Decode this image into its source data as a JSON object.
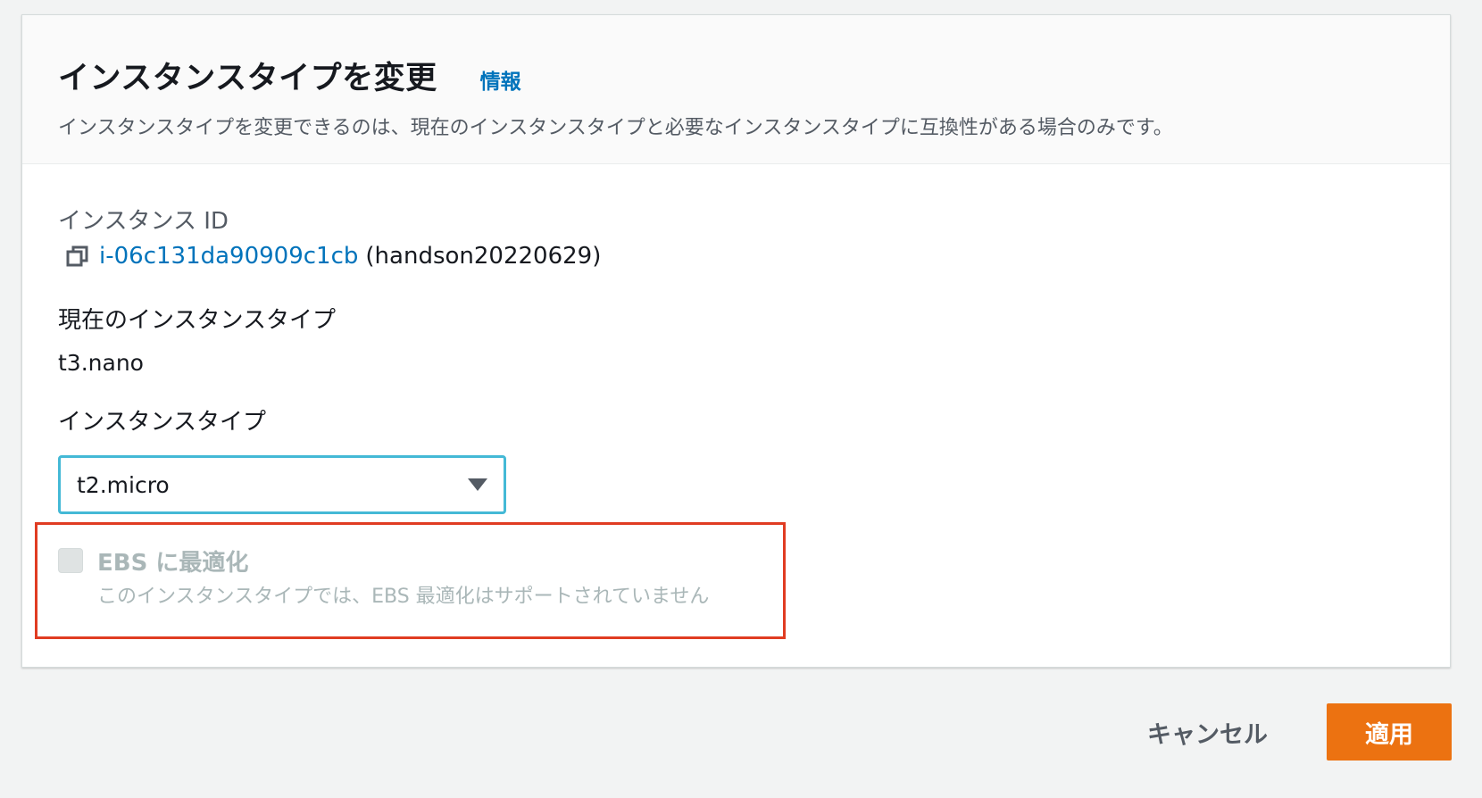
{
  "header": {
    "title": "インスタンスタイプを変更",
    "info_link": "情報",
    "description": "インスタンスタイプを変更できるのは、現在のインスタンスタイプと必要なインスタンスタイプに互換性がある場合のみです。"
  },
  "instance_id": {
    "label": "インスタンス ID",
    "id": "i-06c131da90909c1cb",
    "name": "(handson20220629)"
  },
  "current_type": {
    "label": "現在のインスタンスタイプ",
    "value": "t3.nano"
  },
  "instance_type": {
    "label": "インスタンスタイプ",
    "selected": "t2.micro"
  },
  "ebs": {
    "label": "EBS に最適化",
    "description": "このインスタンスタイプでは、EBS 最適化はサポートされていません",
    "checked": false,
    "disabled": true
  },
  "footer": {
    "cancel_label": "キャンセル",
    "apply_label": "適用"
  },
  "colors": {
    "link": "#0073bb",
    "primary_button": "#ec7211",
    "focus_border": "#44b9d6",
    "highlight_box": "#e03c22"
  },
  "icons": {
    "copy": "copy-icon",
    "caret": "caret-down-icon"
  }
}
